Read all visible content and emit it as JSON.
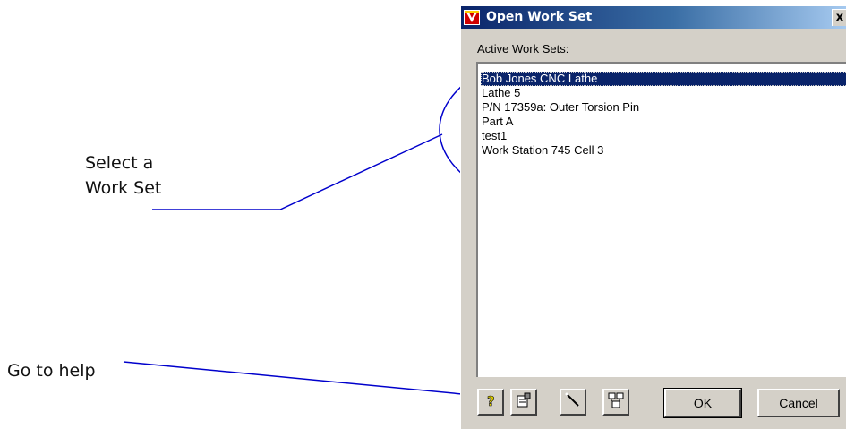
{
  "annotations": {
    "select_line1": "Select a",
    "select_line2": "Work Set",
    "help": "Go to help"
  },
  "dialog": {
    "title": "Open Work Set",
    "close_label": "x",
    "list_label": "Active Work Sets:",
    "items": [
      "Bob Jones CNC Lathe",
      "Lathe 5",
      "P/N 17359a: Outer Torsion Pin",
      "Part A",
      "test1",
      "Work Station 745 Cell 3"
    ],
    "selected_index": 0,
    "toolbar_icons": [
      "help-icon",
      "properties-icon",
      "wand-icon",
      "hierarchy-icon"
    ],
    "ok_label": "OK",
    "cancel_label": "Cancel"
  },
  "colors": {
    "titlebar_start": "#0a246a",
    "titlebar_end": "#a6caf0",
    "selection": "#0a246a",
    "annotation_line": "#0000cc",
    "dialog_face": "#d4d0c8"
  }
}
